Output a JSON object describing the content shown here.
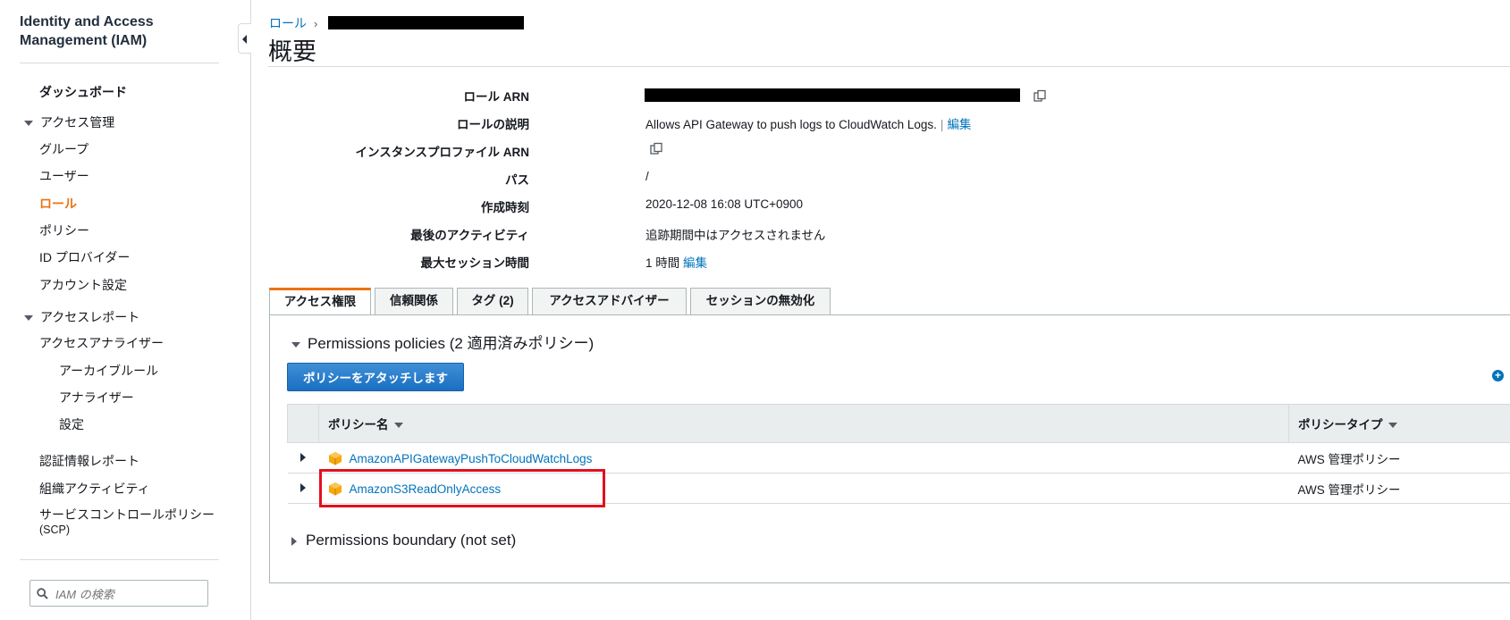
{
  "sidebar": {
    "title_line1": "Identity and Access",
    "title_line2": "Management (IAM)",
    "dashboard": "ダッシュボード",
    "access_mgmt": "アクセス管理",
    "groups": "グループ",
    "users": "ユーザー",
    "roles": "ロール",
    "policies": "ポリシー",
    "id_providers": "ID プロバイダー",
    "account_settings": "アカウント設定",
    "access_reports": "アクセスレポート",
    "access_analyzer": "アクセスアナライザー",
    "archive_rules": "アーカイブルール",
    "analyzers": "アナライザー",
    "settings": "設定",
    "credential_report": "認証情報レポート",
    "org_activity": "組織アクティビティ",
    "scp_line1": "サービスコントロールポリシー",
    "scp_line2": "(SCP)",
    "search_placeholder": "IAM の検索"
  },
  "breadcrumb": {
    "parent": "ロール"
  },
  "page_title": "概要",
  "summary": {
    "role_arn_label": "ロール ARN",
    "description_label": "ロールの説明",
    "description_value": "Allows API Gateway to push logs to CloudWatch Logs.",
    "edit_label": "編集",
    "instance_profile_label": "インスタンスプロファイル ARN",
    "path_label": "パス",
    "path_value": "/",
    "created_label": "作成時刻",
    "created_value": "2020-12-08 16:08 UTC+0900",
    "last_activity_label": "最後のアクティビティ",
    "last_activity_value": "追跡期間中はアクセスされません",
    "max_session_label": "最大セッション時間",
    "max_session_value": "1 時間",
    "max_session_edit": "編集"
  },
  "tabs": {
    "permissions": "アクセス権限",
    "trust": "信頼関係",
    "tags": "タグ (2)",
    "advisor": "アクセスアドバイザー",
    "revoke": "セッションの無効化"
  },
  "permissions": {
    "heading": "Permissions policies (2 適用済みポリシー)",
    "attach_button": "ポリシーをアタッチします",
    "col_name": "ポリシー名",
    "col_type": "ポリシータイプ",
    "rows": [
      {
        "name": "AmazonAPIGatewayPushToCloudWatchLogs",
        "type": "AWS 管理ポリシー"
      },
      {
        "name": "AmazonS3ReadOnlyAccess",
        "type": "AWS 管理ポリシー"
      }
    ],
    "boundary_heading": "Permissions boundary (not set)"
  },
  "colors": {
    "accent": "#ec7211",
    "link": "#0073bb",
    "highlight": "#e3101e",
    "button": "#1a6fc2"
  }
}
